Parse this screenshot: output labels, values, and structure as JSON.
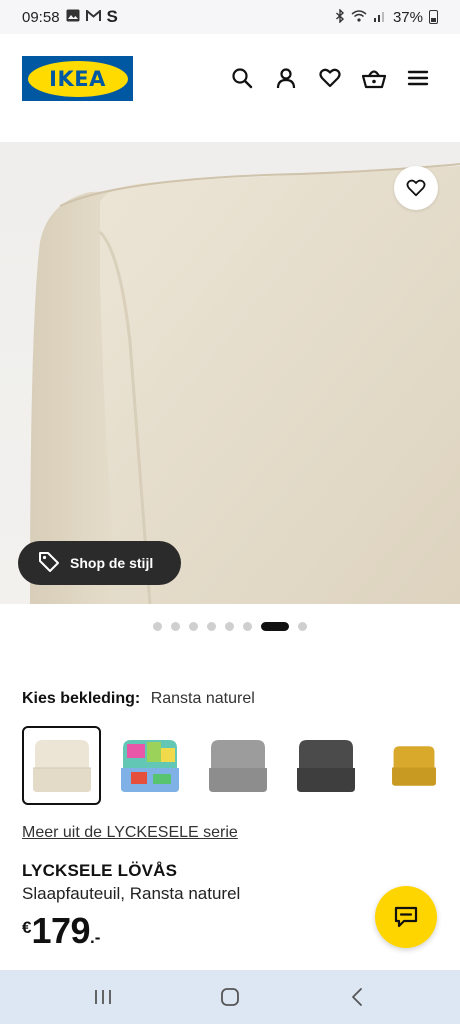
{
  "status": {
    "time": "09:58",
    "carrier": "S",
    "battery": "37%"
  },
  "header": {
    "logo_text": "IKEA",
    "icons": [
      "search-icon",
      "profile-icon",
      "heart-icon",
      "basket-icon",
      "menu-icon"
    ]
  },
  "hero": {
    "shop_style_label": "Shop de stijl",
    "slide_count": 8,
    "active_slide": 7
  },
  "cover": {
    "label": "Kies bekleding:",
    "value": "Ransta naturel",
    "swatches": [
      "naturel",
      "multicolor",
      "light-grey",
      "dark-grey",
      "yellow"
    ],
    "selected_index": 0
  },
  "product": {
    "series_link": "Meer uit de LYCKESELE serie",
    "name": "LYCKSELE LÖVÅS",
    "description": "Slaapfauteuil, Ransta naturel",
    "currency": "€",
    "price_whole": "179",
    "price_suffix": ".-"
  },
  "colors": {
    "ikea_blue": "#0058a3",
    "ikea_yellow": "#ffdb00",
    "chat_yellow": "#ffd500",
    "fabric": "#e9e1d0",
    "navbar_bg": "#dde7f3"
  }
}
